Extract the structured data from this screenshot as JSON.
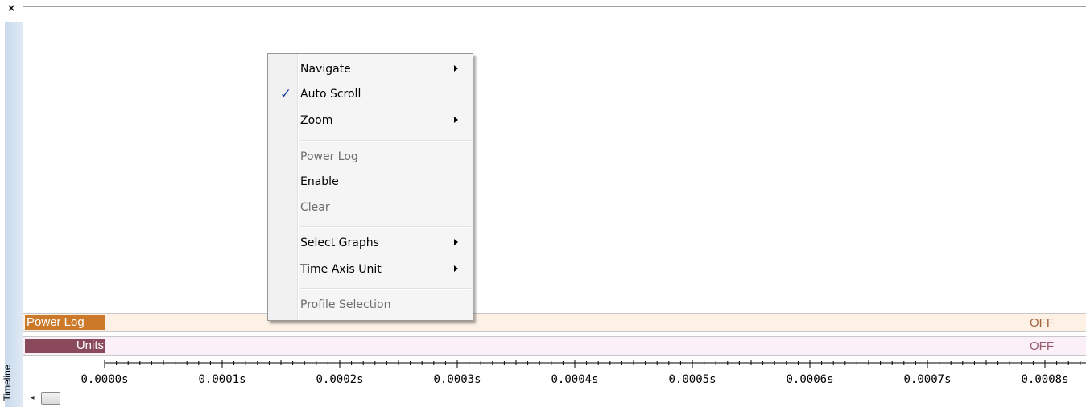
{
  "panel": {
    "title": "Timeline",
    "close_glyph": "×"
  },
  "rows": [
    {
      "label": "Power Log",
      "state": "OFF"
    },
    {
      "label": "Units",
      "state": "OFF"
    }
  ],
  "axis": {
    "ticks": [
      "0.0000s",
      "0.0001s",
      "0.0002s",
      "0.0003s",
      "0.0004s",
      "0.0005s",
      "0.0006s",
      "0.0007s",
      "0.0008s"
    ]
  },
  "scrollbar": {
    "left_arrow": "◂"
  },
  "context_menu": {
    "items": [
      {
        "label": "Navigate",
        "submenu": true,
        "enabled": true,
        "checked": false
      },
      {
        "label": "Auto Scroll",
        "submenu": false,
        "enabled": true,
        "checked": true,
        "check_glyph": "✓"
      },
      {
        "label": "Zoom",
        "submenu": true,
        "enabled": true,
        "checked": false
      },
      {
        "label": "Power Log",
        "submenu": false,
        "enabled": false,
        "checked": false
      },
      {
        "label": "Enable",
        "submenu": false,
        "enabled": true,
        "checked": false
      },
      {
        "label": "Clear",
        "submenu": false,
        "enabled": false,
        "checked": false
      },
      {
        "label": "Select Graphs",
        "submenu": true,
        "enabled": true,
        "checked": false
      },
      {
        "label": "Time Axis Unit",
        "submenu": true,
        "enabled": true,
        "checked": false
      },
      {
        "label": "Profile Selection",
        "submenu": false,
        "enabled": false,
        "checked": false
      }
    ]
  },
  "colors": {
    "power_log_label_bg": "#cc7a2a",
    "units_label_bg": "#8a4a5c",
    "check_color": "#1b3fa0"
  }
}
